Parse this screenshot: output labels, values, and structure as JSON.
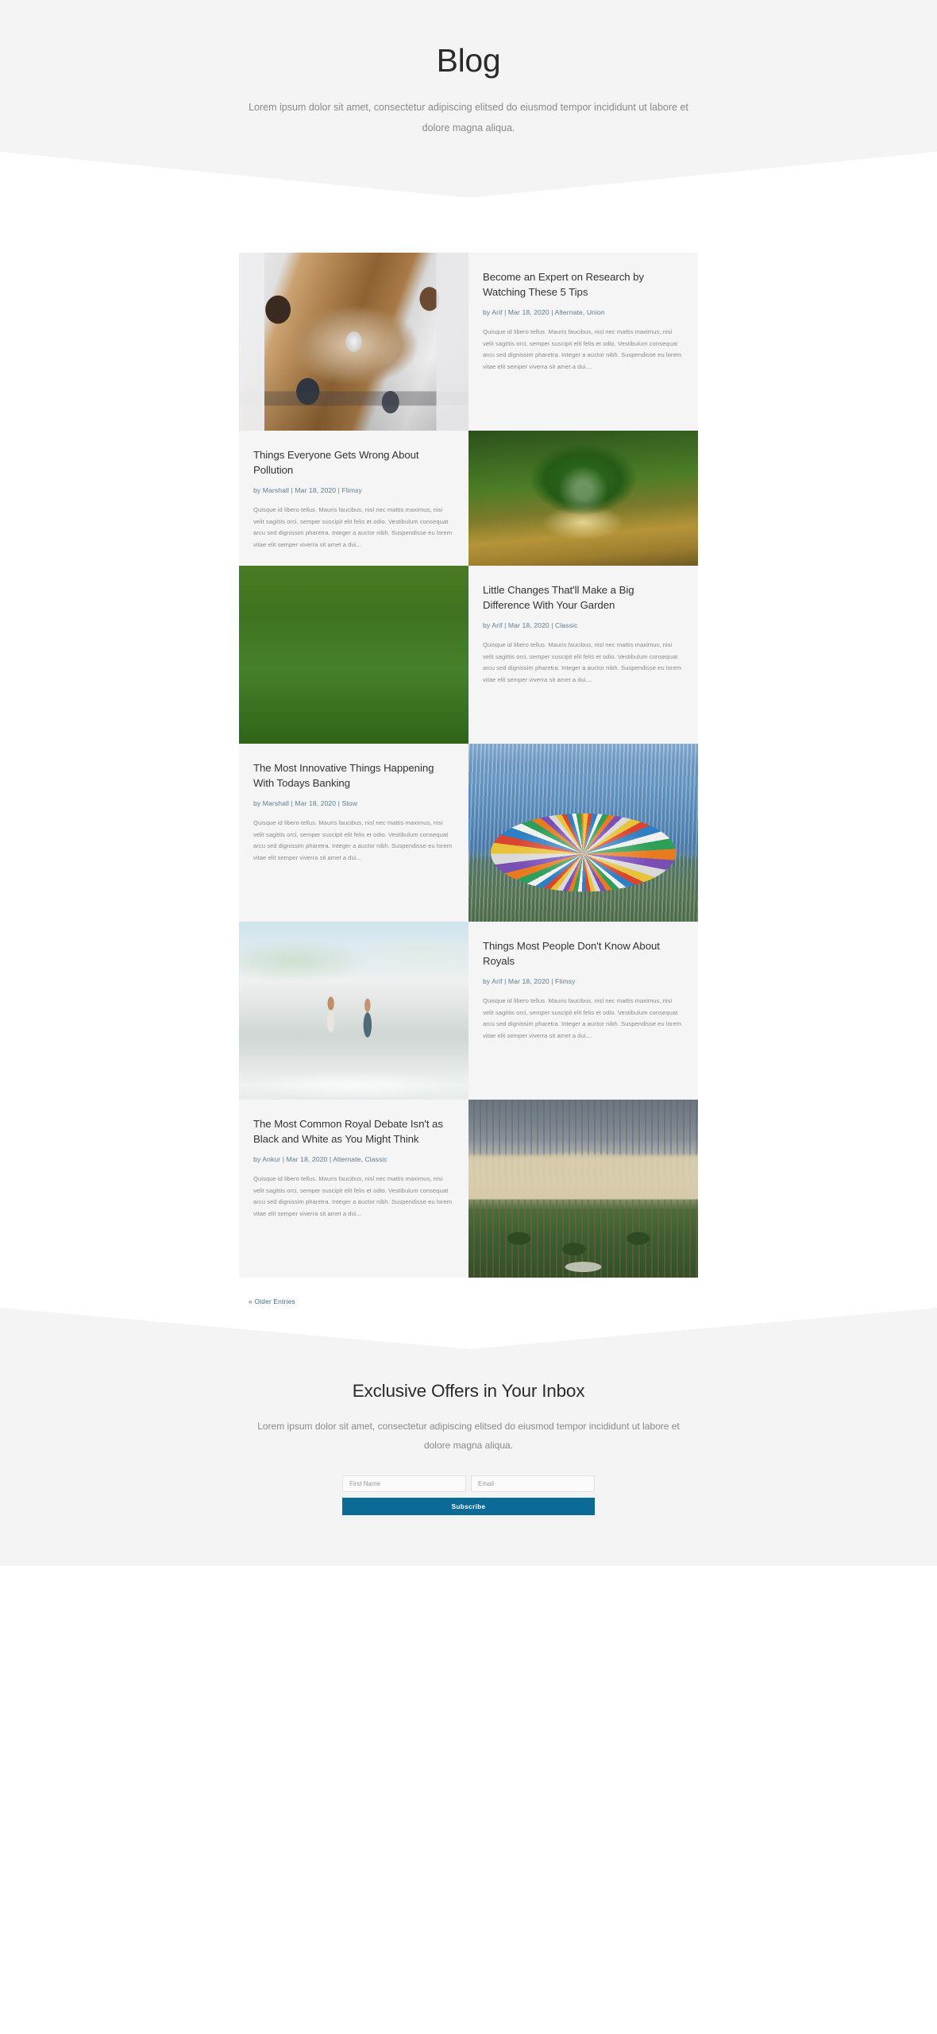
{
  "hero": {
    "title": "Blog",
    "subtitle": "Lorem ipsum dolor sit amet, consectetur adipiscing elitsed do eiusmod tempor incididunt ut labore et dolore magna aliqua."
  },
  "posts": [
    {
      "title": "Become an Expert on Research by Watching These 5 Tips",
      "meta": "by Arif | Mar 18, 2020 | Alternate, Union",
      "author": "Arif",
      "date": "Mar 18, 2020",
      "categories": "Alternate, Union",
      "excerpt": "Quisque id libero tellus. Mauris faucibus, nisl nec mattis maximus, nisi velit sagittis orci, semper suscipit elit felis et odio. Vestibulum consequat arcu sed dignissim pharetra. Integer a auctor nibh. Suspendisse eu lorem vitae elit semper viverra sit amet a dui....",
      "image_alt": "team-fistbump-desk-photo",
      "image_side": "left"
    },
    {
      "title": "Things Everyone Gets Wrong About Pollution",
      "meta": "by Marshall | Mar 18, 2020 | Flimsy",
      "author": "Marshall",
      "date": "Mar 18, 2020",
      "categories": "Flimsy",
      "excerpt": "Quisque id libero tellus. Mauris faucibus, nisl nec mattis maximus, nisi velit sagittis orci, semper suscipit elit felis et odio. Vestibulum consequat arcu sed dignissim pharetra. Integer a auctor nibh. Suspendisse eu lorem vitae elit semper viverra sit amet a dui...",
      "image_alt": "tree-in-glass-globe-photo",
      "image_side": "right"
    },
    {
      "title": "Little Changes That'll Make a Big Difference With Your Garden",
      "meta": "by Arif | Mar 18, 2020 | Classic",
      "author": "Arif",
      "date": "Mar 18, 2020",
      "categories": "Classic",
      "excerpt": "Quisque id libero tellus. Mauris faucibus, nisl nec mattis maximus, nisi velit sagittis orci, semper suscipit elit felis et odio. Vestibulum consequat arcu sed dignissim pharetra. Integer a auctor nibh. Suspendisse eu lorem vitae elit semper viverra sit amet a dui....",
      "image_alt": "wildflower-meadow-photo",
      "image_side": "left"
    },
    {
      "title": "The Most Innovative Things Happening With Todays Banking",
      "meta": "by Marshall | Mar 18, 2020 | Stow",
      "author": "Marshall",
      "date": "Mar 18, 2020",
      "categories": "Stow",
      "excerpt": "Quisque id libero tellus. Mauris faucibus, nisl nec mattis maximus, nisi velit sagittis orci, semper suscipit elit felis et odio. Vestibulum consequat arcu sed dignissim pharetra. Integer a auctor nibh. Suspendisse eu lorem vitae elit semper viverra sit amet a dui...",
      "image_alt": "glass-sculpture-building-photo",
      "image_side": "right"
    },
    {
      "title": "Things Most People Don't Know About Royals",
      "meta": "by Arif | Mar 18, 2020 | Flimsy",
      "author": "Arif",
      "date": "Mar 18, 2020",
      "categories": "Flimsy",
      "excerpt": "Quisque id libero tellus. Mauris faucibus, nisl nec mattis maximus, nisi velit sagittis orci, semper suscipit elit felis et odio. Vestibulum consequat arcu sed dignissim pharetra. Integer a auctor nibh. Suspendisse eu lorem vitae elit semper viverra sit amet a dui....",
      "image_alt": "couple-walking-beach-photo",
      "image_side": "left"
    },
    {
      "title": "The Most Common Royal Debate Isn't as Black and White as You Might Think",
      "meta": "by Ankur | Mar 18, 2020 | Alternate, Classic",
      "author": "Ankur",
      "date": "Mar 18, 2020",
      "categories": "Alternate, Classic",
      "excerpt": "Quisque id libero tellus. Mauris faucibus, nisl nec mattis maximus, nisi velit sagittis orci, semper suscipit elit felis et odio. Vestibulum consequat arcu sed dignissim pharetra. Integer a auctor nibh. Suspendisse eu lorem vitae elit semper viverra sit amet a dui...",
      "image_alt": "palace-garden-photo",
      "image_side": "right"
    }
  ],
  "pagination": {
    "older_label": "« Older Entries"
  },
  "cta": {
    "title": "Exclusive Offers in Your Inbox",
    "subtitle": "Lorem ipsum dolor sit amet, consectetur adipiscing elitsed do eiusmod tempor incididunt ut labore et dolore magna aliqua.",
    "first_name_placeholder": "First Name",
    "first_name_value": "",
    "email_placeholder": "Email",
    "email_value": "",
    "subscribe_label": "Subscribe"
  },
  "colors": {
    "band_background": "#f4f4f4",
    "card_background": "#f5f5f5",
    "page_background": "#ffffff",
    "title_text": "#333333",
    "meta_link": "#5d7e96",
    "body_text": "#8c8c8c",
    "button_background": "#0b6a96",
    "button_text": "#ffffff",
    "pagination_link": "#3f6a8a"
  }
}
